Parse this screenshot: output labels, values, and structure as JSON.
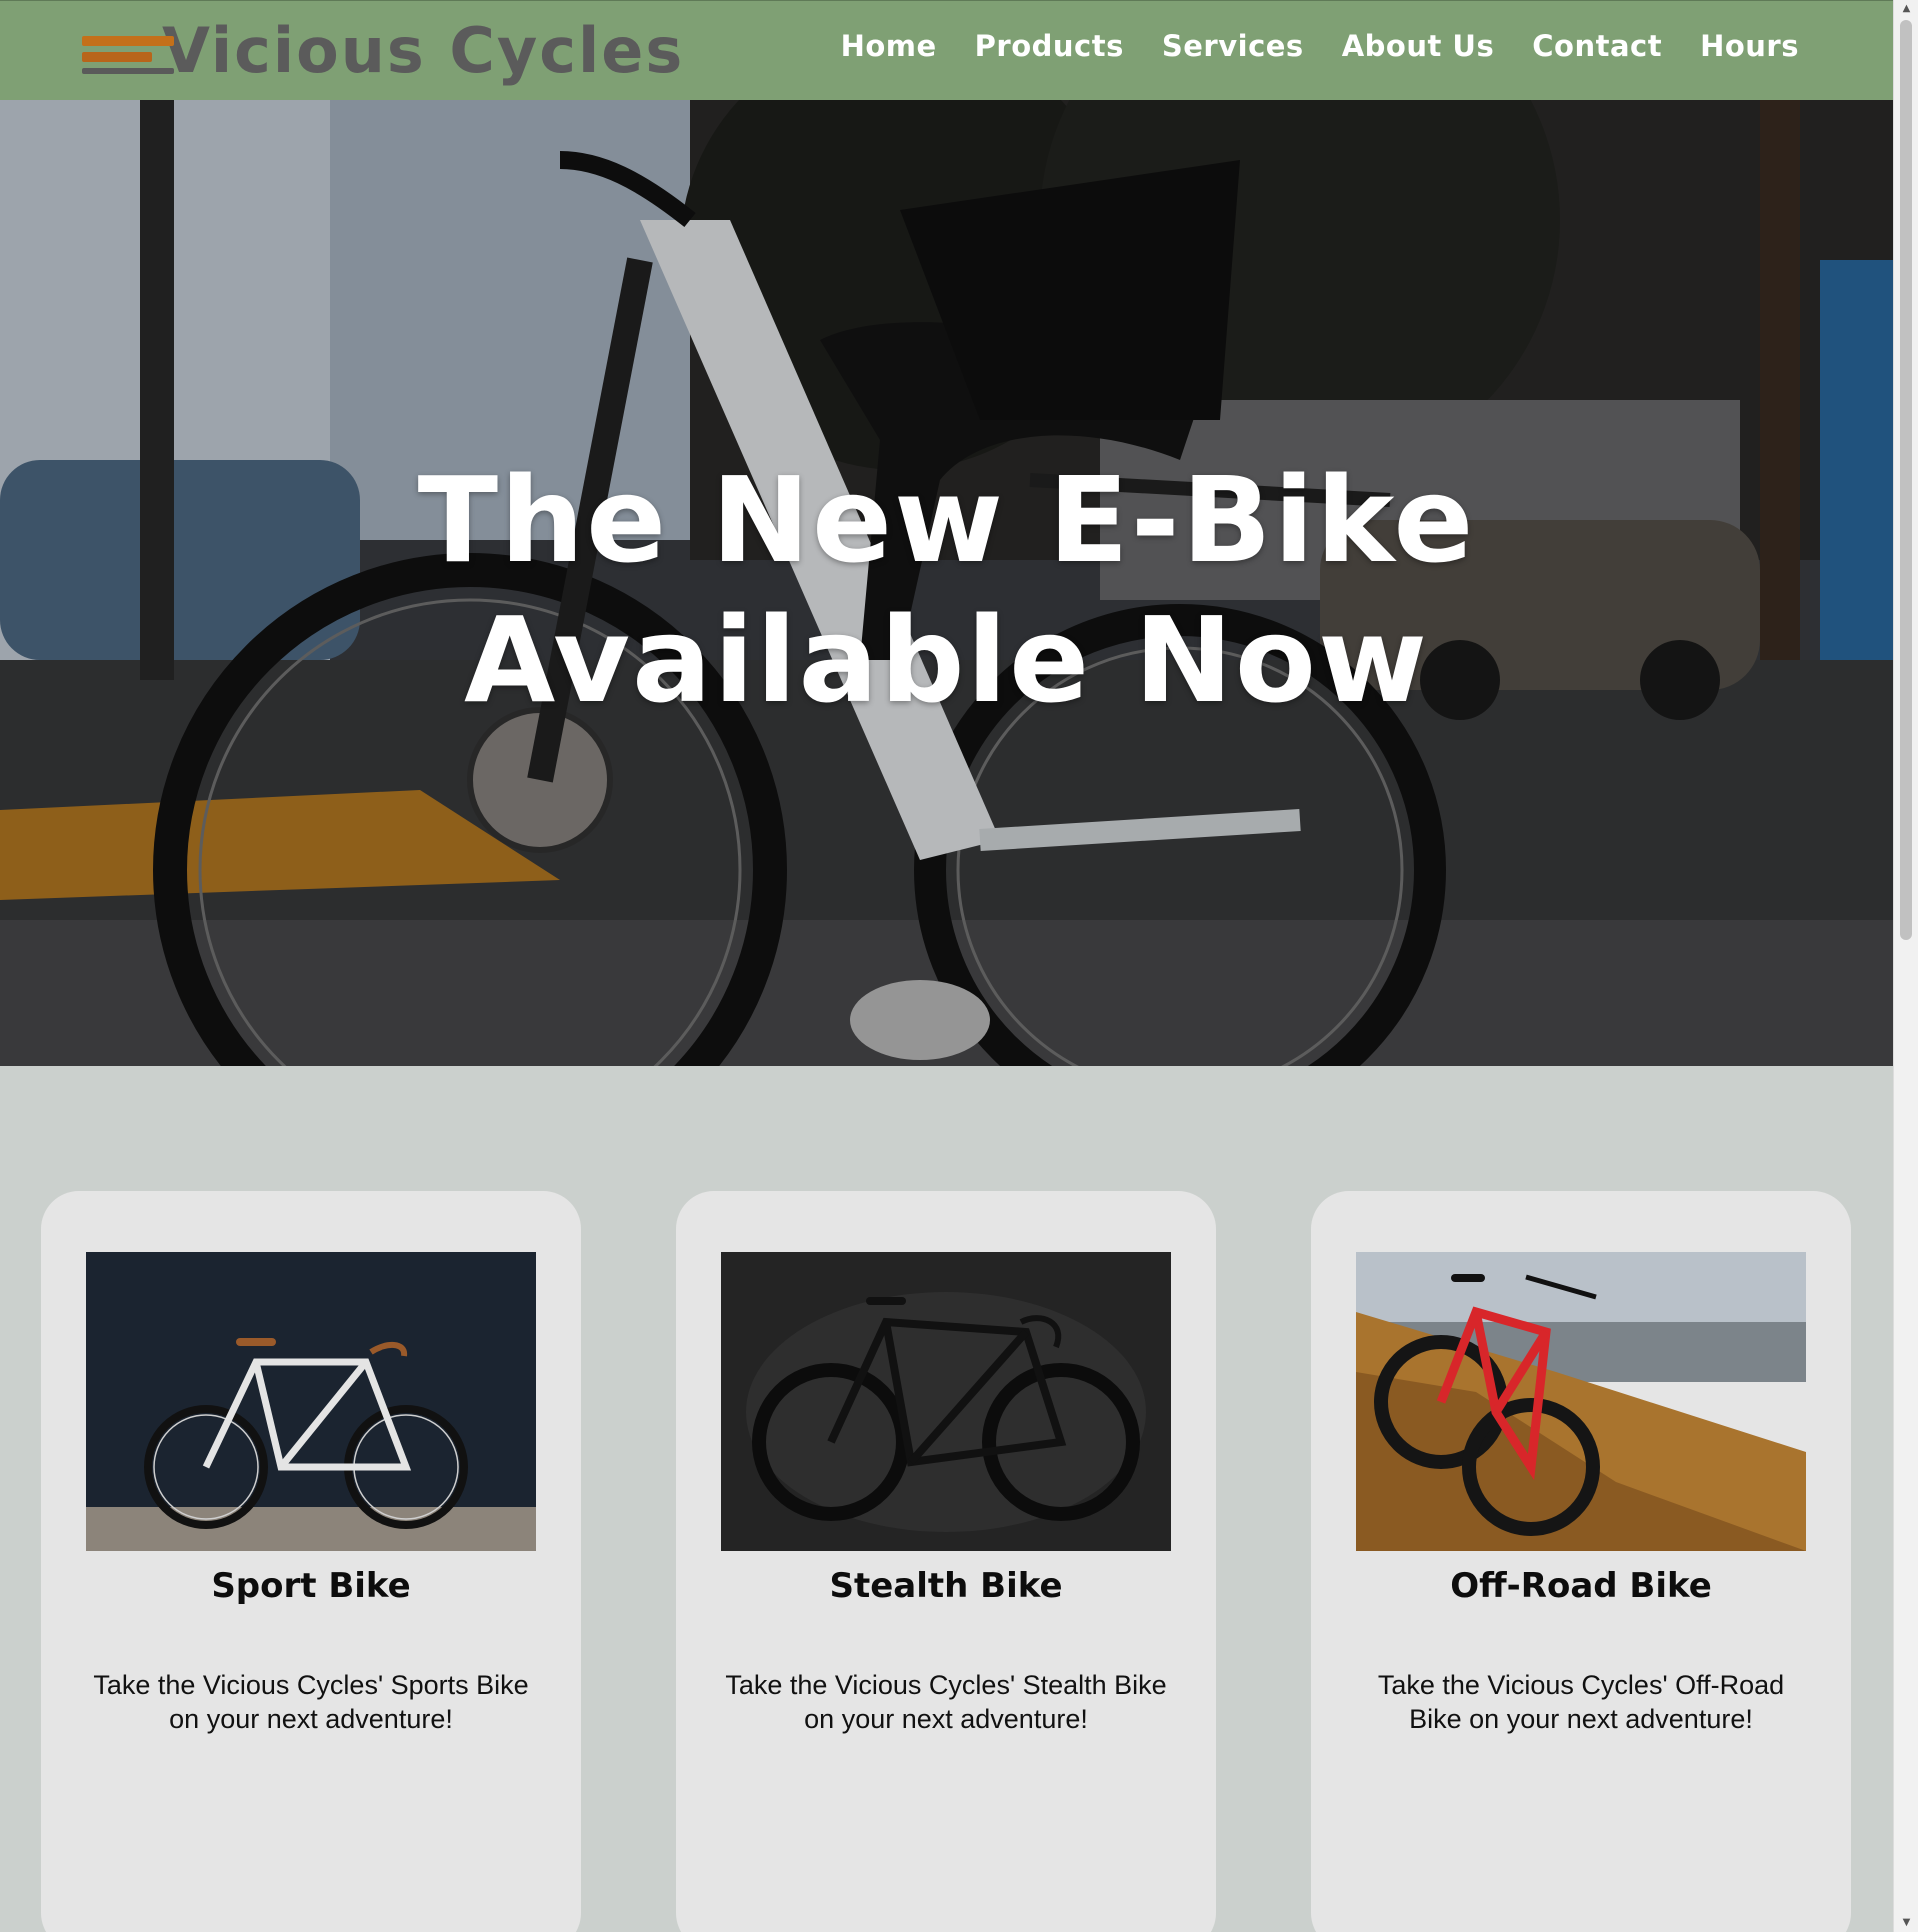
{
  "brand": {
    "name": "Vicious Cycles",
    "stripe_colors": [
      "#c4701a",
      "#b8651a",
      "#5a5a5a"
    ]
  },
  "nav": {
    "items": [
      "Home",
      "Products",
      "Services",
      "About Us",
      "Contact",
      "Hours"
    ]
  },
  "hero": {
    "line1": "The New E-Bike",
    "line2": "Available Now"
  },
  "products": [
    {
      "title": "Sport Bike",
      "description": "Take the Vicious Cycles' Sports Bike on your next adventure!"
    },
    {
      "title": "Stealth Bike",
      "description": "Take the Vicious Cycles' Stealth Bike on your next adventure!"
    },
    {
      "title": "Off-Road Bike",
      "description": "Take the Vicious Cycles' Off-Road Bike on your next adventure!"
    }
  ],
  "colors": {
    "header": "#7fa074",
    "page_bg": "#cbd0cd",
    "card_bg": "#e5e5e5"
  }
}
